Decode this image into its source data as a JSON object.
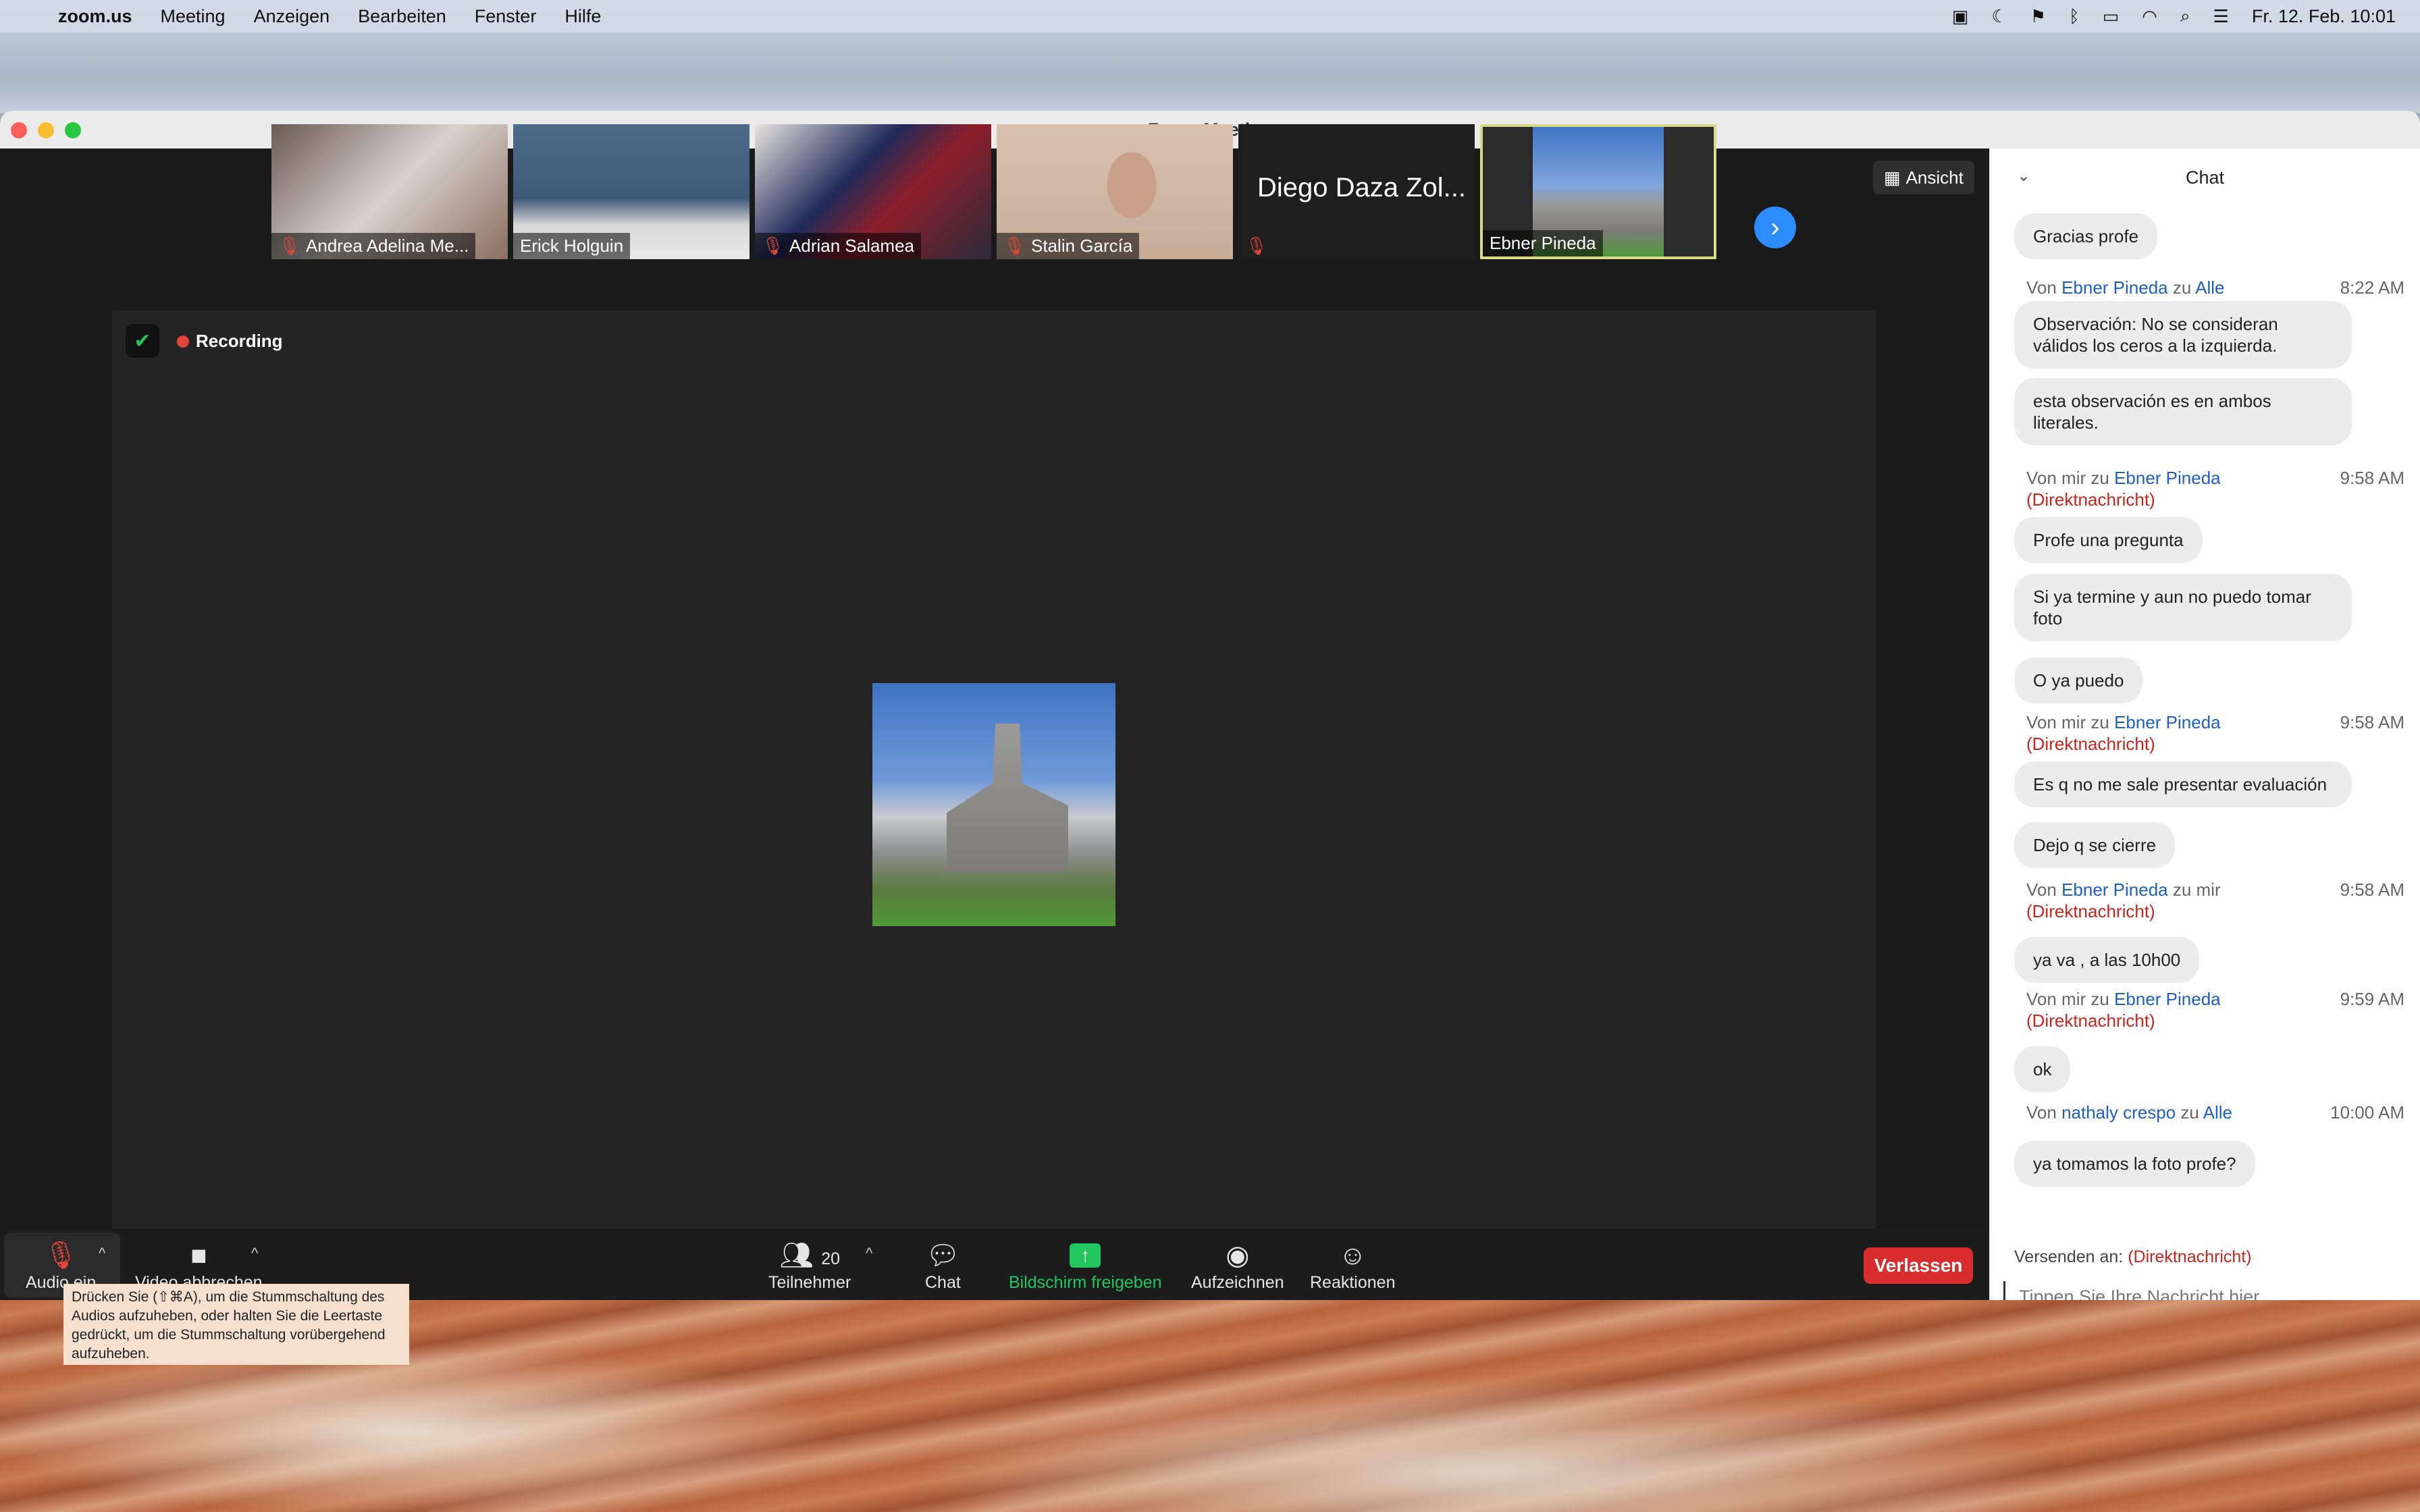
{
  "menubar": {
    "app": "zoom.us",
    "items": [
      "Meeting",
      "Anzeigen",
      "Bearbeiten",
      "Fenster",
      "Hilfe"
    ],
    "clock": "Fr. 12. Feb.  10:01",
    "status_icons": [
      "zoom-icon",
      "moon-icon",
      "flag-us-icon",
      "bluetooth-icon",
      "battery-icon",
      "wifi-icon",
      "search-icon",
      "control-center-icon"
    ]
  },
  "window": {
    "title": "Zoom-Meeting"
  },
  "thumbnails": [
    {
      "name": "Andrea Adelina Me...",
      "muted": true
    },
    {
      "name": "Erick Holguin",
      "muted": false
    },
    {
      "name": "Adrian Salamea",
      "muted": true
    },
    {
      "name": "Stalin García",
      "muted": true
    },
    {
      "name": "Diego Daza Zol...",
      "muted": true
    },
    {
      "name": "Ebner Pineda",
      "muted": false,
      "active": true
    }
  ],
  "view_button": "Ansicht",
  "recording_label": "Recording",
  "toolbar": {
    "audio_label": "Audio ein",
    "video_label": "Video abbrechen",
    "participants_count": "20",
    "participants_label": "Teilnehmer",
    "chat_label": "Chat",
    "share_label": "Bildschirm freigeben",
    "record_label": "Aufzeichnen",
    "reactions_label": "Reaktionen",
    "leave_label": "Verlassen"
  },
  "tooltip": "Drücken Sie  (⇧⌘A), um die Stummschaltung des Audios aufzuheben, oder halten Sie die Leertaste gedrückt, um die Stummschaltung vorübergehend aufzuheben.",
  "chat": {
    "title": "Chat",
    "messages": [
      {
        "text": "Gracias profe"
      },
      {
        "meta_prefix": "Von ",
        "from": "Ebner Pineda",
        "mid": " zu ",
        "to": "Alle",
        "time": "8:22 AM"
      },
      {
        "text": "Observación: No se consideran válidos los ceros a la izquierda."
      },
      {
        "text": "esta observación es en ambos literales."
      },
      {
        "meta_prefix": "Von mir zu ",
        "to": "Ebner Pineda",
        "dm": "(Direktnachricht)",
        "time": "9:58 AM"
      },
      {
        "text": "Profe una pregunta"
      },
      {
        "text": "Si ya termine y aun no puedo tomar foto"
      },
      {
        "text": "O ya puedo"
      },
      {
        "meta_prefix": "Von mir zu ",
        "to": "Ebner Pineda",
        "dm": "(Direktnachricht)",
        "time": "9:58 AM"
      },
      {
        "text": "Es q no me sale presentar evaluación"
      },
      {
        "text": "Dejo q se cierre"
      },
      {
        "meta_prefix": "Von ",
        "from": "Ebner Pineda",
        "mid": " zu mir",
        "dm": "(Direktnachricht)",
        "time": "9:58 AM"
      },
      {
        "text": "ya va , a las 10h00"
      },
      {
        "meta_prefix": "Von mir zu ",
        "to": "Ebner Pineda",
        "dm": "(Direktnachricht)",
        "time": "9:59 AM"
      },
      {
        "text": "ok"
      },
      {
        "meta_prefix": "Von ",
        "from": "nathaly crespo",
        "mid": " zu ",
        "to": "Alle",
        "time": "10:00 AM"
      },
      {
        "text": "ya tomamos la foto profe?"
      }
    ],
    "send_to_label": "Versenden an:",
    "send_to_value": "(Direktnachricht)",
    "input_placeholder": "Tippen Sie Ihre Nachricht hier..."
  }
}
